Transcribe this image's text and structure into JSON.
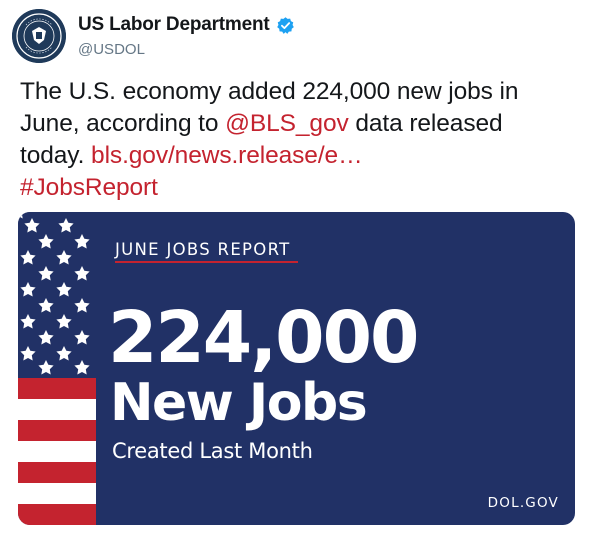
{
  "account": {
    "display_name": "US Labor Department",
    "handle": "@USDOL",
    "verified": true,
    "avatar_icon": "department-of-labor-seal"
  },
  "tweet": {
    "text_before": "The U.S. economy added 224,000 new jobs in June, according to ",
    "mention": "@BLS_gov",
    "text_middle": " data released today.",
    "link": "bls.gov/news.release/e…",
    "hashtag": "#JobsReport",
    "link_color": "#c4232f"
  },
  "card": {
    "kicker": "JUNE JOBS REPORT",
    "big_number": "224,000",
    "big_label": "New Jobs",
    "sub_label": "Created Last Month",
    "site": "DOL.GOV",
    "background_color": "#213166",
    "accent_color": "#c4232f",
    "flag_icon": "american-flag-stars-stripes"
  }
}
